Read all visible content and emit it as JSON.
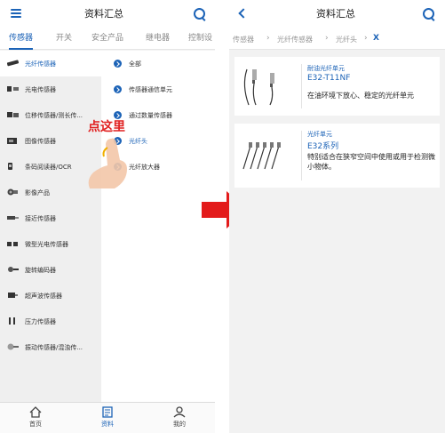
{
  "left": {
    "title": "资料汇总",
    "tabs": [
      "传感器",
      "开关",
      "安全产品",
      "继电器",
      "控制设"
    ],
    "categories": [
      "光纤传感器",
      "光电传感器",
      "位移传感器/测长传...",
      "图像传感器",
      "条码阅读器/OCR",
      "影像产品",
      "接近传感器",
      "微型光电传感器",
      "旋转编码器",
      "超声波传感器",
      "压力传感器",
      "振动传感器/混浊传..."
    ],
    "subcategories": [
      "全部",
      "传感器通信单元",
      "通过数量传感器",
      "光纤头",
      "光纤放大器"
    ],
    "click_hint": "点这里",
    "tabbar": [
      "首页",
      "资料",
      "我的"
    ]
  },
  "right": {
    "title": "资料汇总",
    "breadcrumb": [
      "传感器",
      "光纤传感器",
      "光纤头"
    ],
    "breadcrumb_clear": "X",
    "products": [
      {
        "subtitle": "耐油光纤单元",
        "model": "E32-T11NF",
        "description": "在油环境下放心、稳定的光纤单元"
      },
      {
        "subtitle": "光纤单元",
        "model": "E32系列",
        "description": "特别适合在狭窄空间中使用或用于检测微小物体。"
      }
    ]
  },
  "colors": {
    "accent": "#1c63b7",
    "hint": "#e02020",
    "arrow": "#e31b1b"
  },
  "icons": {
    "left_header_left": "menu-icon",
    "left_header_right": "search-icon",
    "right_header_left": "back-arrow-icon",
    "right_header_right": "search-icon",
    "transition": "red-arrow-icon",
    "tabbar": [
      "home-icon",
      "document-icon",
      "user-icon"
    ]
  }
}
